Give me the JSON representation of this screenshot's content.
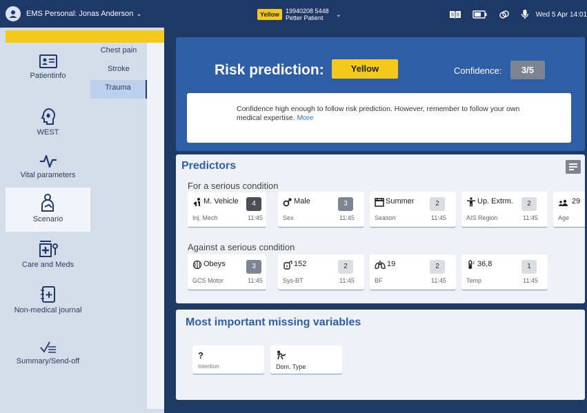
{
  "topbar": {
    "user_label": "EMS Personal: Jonas Anderson",
    "patient_tag": "Yellow",
    "patient_id": "19940208 5448",
    "patient_name": "Petter Patient",
    "datetime": "Wed 5 Apr 14:01"
  },
  "nav": {
    "items": [
      {
        "label": "Patientinfo",
        "icon": "patient-card-icon"
      },
      {
        "label": "WEST",
        "icon": "head-icon"
      },
      {
        "label": "Vital parameters",
        "icon": "pulse-icon"
      },
      {
        "label": "Scenario",
        "icon": "scenario-icon"
      },
      {
        "label": "Care and Meds",
        "icon": "medkit-icon"
      },
      {
        "label": "Non-medical journal",
        "icon": "journal-icon"
      },
      {
        "label": "Summary/Send-off",
        "icon": "summary-icon"
      }
    ],
    "sub_items": [
      "Chest pain",
      "Stroke",
      "Trauma"
    ]
  },
  "risk": {
    "title": "Risk prediction:",
    "level": "Yellow",
    "confidence_label": "Confidence:",
    "confidence_value": "3/5",
    "info_text": "Confidence high enough to follow risk prediction. However, remember to follow your own medical expertise.",
    "more_link": "More"
  },
  "predictors": {
    "title": "Predictors",
    "serious_title": "For a serious condition",
    "against_title": "Against a serious condition",
    "serious": [
      {
        "value": "M. Vehicle",
        "count": "4",
        "label": "Inj. Mech",
        "time": "11:45"
      },
      {
        "value": "Male",
        "count": "3",
        "label": "Sex",
        "time": "11:45"
      },
      {
        "value": "Summer",
        "count": "2",
        "label": "Season",
        "time": "11:45"
      },
      {
        "value": "Up. Extrm.",
        "count": "2",
        "label": "AIS Region",
        "time": "11:45"
      },
      {
        "value": "29",
        "label": "Age"
      }
    ],
    "against": [
      {
        "value": "Obeys",
        "count": "3",
        "label": "GCS Motor",
        "time": "11:45"
      },
      {
        "value": "152",
        "count": "2",
        "label": "Sys-BT",
        "time": "11:45"
      },
      {
        "value": "19",
        "count": "2",
        "label": "BF",
        "time": "11:45"
      },
      {
        "value": "36,8",
        "count": "1",
        "label": "Temp",
        "time": "11:45"
      }
    ]
  },
  "missing": {
    "title": "Most important missing variables",
    "items": [
      {
        "value": "?",
        "label": "Intention"
      },
      {
        "label": "Dom. Type"
      }
    ]
  },
  "colors": {
    "topbar": "#1e3868",
    "panel_blue": "#2d5ea6",
    "yellow": "#f4c91c"
  }
}
